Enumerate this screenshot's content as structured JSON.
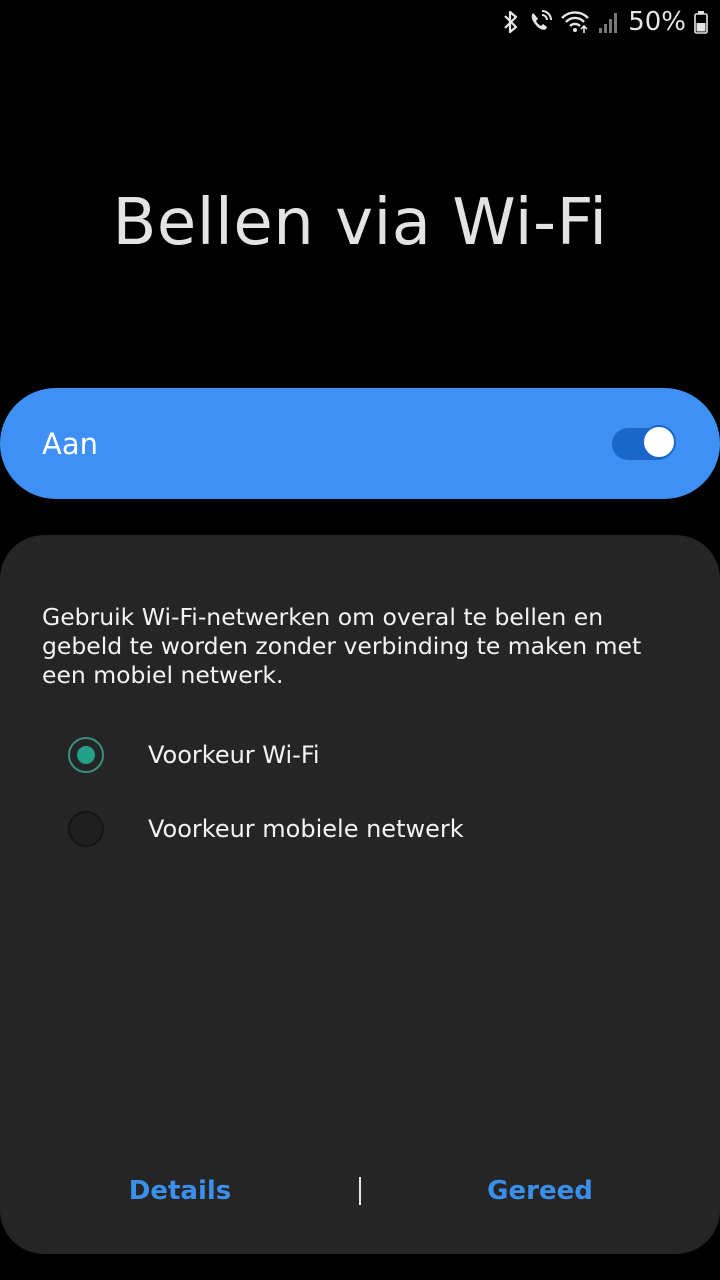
{
  "status_bar": {
    "battery_percent": "50%",
    "icons": [
      "bluetooth-icon",
      "wifi-calling-icon",
      "wifi-signal-icon",
      "cell-signal-icon",
      "battery-icon"
    ]
  },
  "page": {
    "title": "Bellen via Wi-Fi"
  },
  "master_switch": {
    "label": "Aan",
    "state": "on"
  },
  "panel": {
    "description": "Gebruik Wi-Fi-netwerken om overal te bellen en gebeld te worden zonder verbinding te maken met een mobiel netwerk.",
    "options": [
      {
        "label": "Voorkeur Wi-Fi",
        "selected": true
      },
      {
        "label": "Voorkeur mobiele netwerk",
        "selected": false
      }
    ]
  },
  "footer": {
    "details_label": "Details",
    "done_label": "Gereed"
  },
  "colors": {
    "accent_blue": "#3e91f3",
    "button_text_blue": "#3a8fec",
    "radio_teal": "#23a08a",
    "panel_background": "#252525"
  }
}
